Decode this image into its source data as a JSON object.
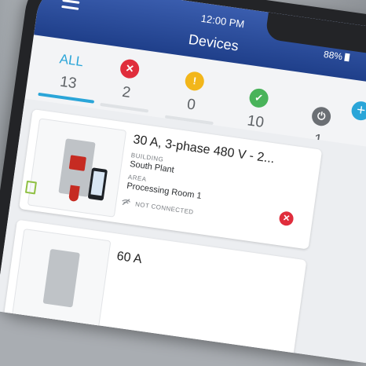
{
  "status_bar": {
    "time": "12:00 PM",
    "battery": "88%"
  },
  "header": {
    "title": "Devices"
  },
  "filters": {
    "all": {
      "label": "ALL",
      "count": "13"
    },
    "error": {
      "icon": "✕",
      "count": "2",
      "color": "#e02d3c"
    },
    "warning": {
      "icon": "!",
      "count": "0",
      "color": "#f2b61b"
    },
    "ok": {
      "icon": "✓",
      "count": "10",
      "color": "#49b35a"
    },
    "offline": {
      "icon": "⏻",
      "count": "1",
      "color": "#6b6f74"
    },
    "add_label": "+"
  },
  "devices": [
    {
      "name": "30 A, 3-phase 480 V - 2...",
      "building_label": "BUILDING",
      "building": "South Plant",
      "area_label": "AREA",
      "area": "Processing Room 1",
      "connection": "NOT CONNECTED",
      "status_icon": "✕"
    },
    {
      "name": "60 A"
    }
  ],
  "colors": {
    "header": "#2b4c9c",
    "accent": "#2aa5d8"
  }
}
